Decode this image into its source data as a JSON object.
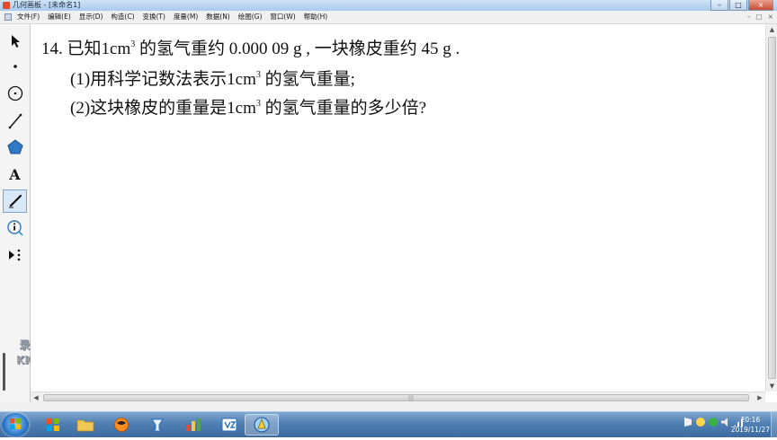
{
  "window": {
    "title": "几何画板 - [未命名1]",
    "minimize_glyph": "–",
    "maximize_glyph": "□",
    "close_glyph": "×"
  },
  "menu": {
    "items": [
      "文件(F)",
      "编辑(E)",
      "显示(D)",
      "构造(C)",
      "变换(T)",
      "度量(M)",
      "数据(N)",
      "绘图(G)",
      "窗口(W)",
      "帮助(H)"
    ],
    "right_glyphs": [
      "–",
      "□",
      "×"
    ]
  },
  "toolbox": {
    "tools": [
      {
        "name": "arrow-tool",
        "icon": "arrow-icon"
      },
      {
        "name": "point-tool",
        "icon": "point-icon"
      },
      {
        "name": "compass-tool",
        "icon": "circle-icon"
      },
      {
        "name": "straightedge-tool",
        "icon": "line-icon"
      },
      {
        "name": "polygon-tool",
        "icon": "polygon-icon"
      },
      {
        "name": "text-tool",
        "icon": "text-icon",
        "label": "A"
      },
      {
        "name": "marker-tool",
        "icon": "marker-icon",
        "selected": true
      },
      {
        "name": "information-tool",
        "icon": "info-icon"
      },
      {
        "name": "custom-tool",
        "icon": "custom-tools-icon"
      }
    ]
  },
  "watermark": {
    "line1": "录制工具",
    "line2": "KK录像机"
  },
  "problem": {
    "number": "14.",
    "q_part1": "已知1",
    "q_unit": "cm",
    "q_sup": "3",
    "q_part2": " 的氢气重约 0.000 09 g , 一块橡皮重约 45 g .",
    "p1_prefix": "(1)用科学记数法表示1",
    "p1_unit": "cm",
    "p1_sup": "3",
    "p1_suffix": " 的氢气重量;",
    "p2_prefix": "(2)这块橡皮的重量是1",
    "p2_unit": "cm",
    "p2_sup": "3",
    "p2_suffix": " 的氢气重量的多少倍?"
  },
  "taskbar": {
    "apps": [
      {
        "name": "explorer-files-button",
        "icon": "folder-icon"
      },
      {
        "name": "media-player-button",
        "icon": "media-icon"
      },
      {
        "name": "app-cup-button",
        "icon": "cup-icon"
      },
      {
        "name": "app-chart-button",
        "icon": "chart-icon"
      },
      {
        "name": "app-vs-button",
        "icon": "vs-icon"
      },
      {
        "name": "geometry-sketchpad-button",
        "icon": "sketchpad-icon",
        "active": true
      }
    ],
    "clock_time": "20:16",
    "clock_date": "2019/11/27"
  },
  "colors": {
    "taskbar_top": "#7fa6cf",
    "taskbar_bottom": "#3c6aa0",
    "selected_tool": "#d9e8f7"
  }
}
